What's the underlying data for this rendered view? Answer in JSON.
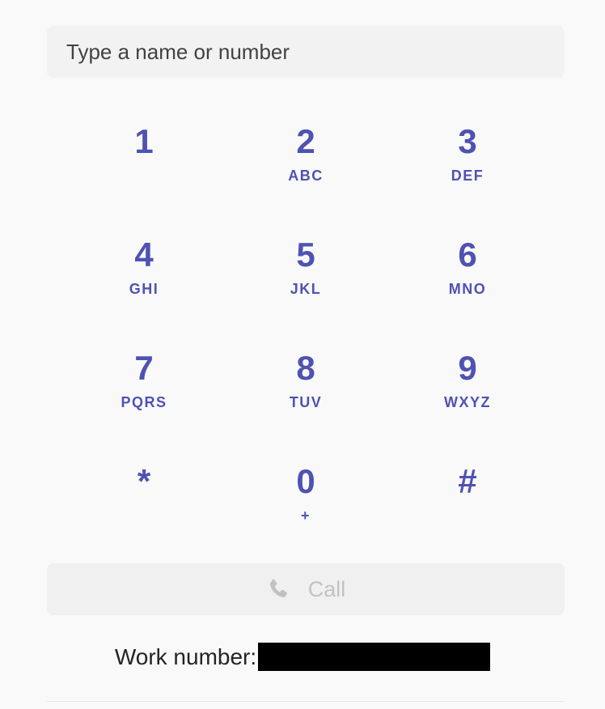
{
  "search": {
    "placeholder": "Type a name or number",
    "value": ""
  },
  "keypad": {
    "keys": [
      {
        "digit": "1",
        "letters": ""
      },
      {
        "digit": "2",
        "letters": "ABC"
      },
      {
        "digit": "3",
        "letters": "DEF"
      },
      {
        "digit": "4",
        "letters": "GHI"
      },
      {
        "digit": "5",
        "letters": "JKL"
      },
      {
        "digit": "6",
        "letters": "MNO"
      },
      {
        "digit": "7",
        "letters": "PQRS"
      },
      {
        "digit": "8",
        "letters": "TUV"
      },
      {
        "digit": "9",
        "letters": "WXYZ"
      },
      {
        "digit": "*",
        "letters": ""
      },
      {
        "digit": "0",
        "letters": "+"
      },
      {
        "digit": "#",
        "letters": ""
      }
    ]
  },
  "call": {
    "label": "Call",
    "icon": "phone-icon",
    "enabled": false
  },
  "work_number": {
    "label": "Work number:",
    "value_redacted": true
  },
  "colors": {
    "accent": "#4f52b2",
    "background": "#f9f9f9",
    "disabled_text": "#c2c2c2"
  }
}
